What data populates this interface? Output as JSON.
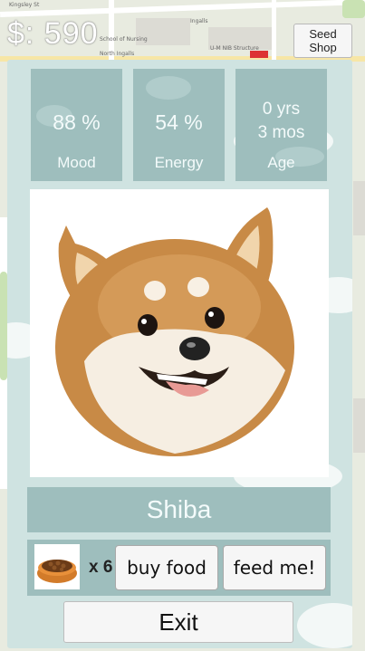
{
  "header": {
    "money": "$: 590",
    "seed_shop_label": "Seed\nShop"
  },
  "stats": [
    {
      "value": "88 %",
      "label": "Mood"
    },
    {
      "value": "54 %",
      "label": "Energy"
    },
    {
      "value_line1": "0 yrs",
      "value_line2": "3 mos",
      "label": "Age"
    }
  ],
  "pet": {
    "name": "Shiba",
    "image": "shiba-dog-face"
  },
  "food": {
    "icon": "dog-food-bowl-icon",
    "count": "x 6",
    "buy_label": "buy food",
    "feed_label": "feed me!"
  },
  "exit_label": "Exit",
  "map_labels": {
    "street1": "Kingsley St",
    "street2": "School of Nursing",
    "street3": "North Ingalls",
    "street4": "U-M NIB Structure",
    "street5": "Ingalls"
  },
  "colors": {
    "panel": "#cfe3e1",
    "tile": "#9ebebd",
    "tile_text": "#f4fbfb"
  }
}
